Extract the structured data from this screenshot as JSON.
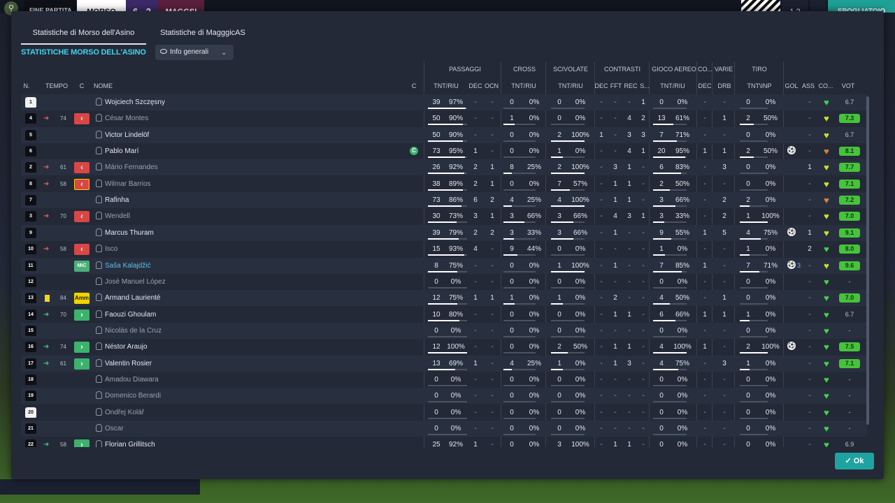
{
  "topbar": {
    "fine_partita": "FINE PARTITA",
    "home_team": "MORSO",
    "score": "6 - 2",
    "away_team": "MAGGSI",
    "mini_score": "1 2",
    "spogliatoio": "SPOGLIATOIO"
  },
  "tabs": [
    "Statistiche di Morso dell'Asino",
    "Statistiche di MagggicAS"
  ],
  "section_title": "STATISTICHE MORSO DELL'ASINO",
  "view_dropdown": "Info generali",
  "ok_label": "Ok",
  "groups": [
    "PASSAGGI",
    "CROSS",
    "SCIVOLATE",
    "CONTRASTI",
    "GIOCO AEREO",
    "CO...",
    "VARIE",
    "TIRO"
  ],
  "columns": {
    "n": "N.",
    "tempo": "TEMPO",
    "c": "C",
    "nome": "NOME",
    "c2": "C",
    "pass_tr": "TNT/RIU",
    "pass_dec": "DEC",
    "pass_ocn": "OCN",
    "cross_tr": "TNT/RIU",
    "sciv_tr": "TNT/RIU",
    "cont_dec": "DEC",
    "cont_fft": "FFT",
    "cont_rec": "REC",
    "cont_s": "S...",
    "aer_tr": "TNT/RIU",
    "co_dec": "DEC",
    "varie_drb": "DRB",
    "tiro_tr": "TNT\\INP",
    "gol": "GOL",
    "ass": "ASS",
    "co": "CO...",
    "vot": "VOT"
  },
  "players": [
    {
      "num": "1",
      "gk": true,
      "ev": "",
      "min": "",
      "badge": "",
      "name": "Wojciech Szczęsny",
      "dim": false,
      "cap": false,
      "p": [
        "39",
        "97%",
        "-",
        "-"
      ],
      "cr": [
        "0",
        "0%"
      ],
      "sc": [
        "0",
        "0%"
      ],
      "ct": [
        "-",
        "-",
        "-",
        "1"
      ],
      "ae": [
        "0",
        "0%"
      ],
      "cd": "-",
      "dr": "-",
      "ti": [
        "0",
        "0%"
      ],
      "gol": "",
      "ass": "-",
      "heart": "#3fd34a",
      "vot": "6.7",
      "vg": false
    },
    {
      "num": "4",
      "gk": false,
      "ev": "out",
      "min": "74",
      "badge": "out",
      "name": "César Montes",
      "dim": true,
      "cap": false,
      "p": [
        "50",
        "90%",
        "-",
        "-"
      ],
      "cr": [
        "1",
        "0%"
      ],
      "sc": [
        "0",
        "0%"
      ],
      "ct": [
        "-",
        "-",
        "4",
        "2"
      ],
      "ae": [
        "13",
        "61%"
      ],
      "cd": "-",
      "dr": "1",
      "ti": [
        "2",
        "50%"
      ],
      "gol": "",
      "ass": "-",
      "heart": "#cde02a",
      "vot": "7.3",
      "vg": true
    },
    {
      "num": "5",
      "gk": false,
      "ev": "",
      "min": "",
      "badge": "",
      "name": "Victor Lindelöf",
      "dim": false,
      "cap": false,
      "p": [
        "50",
        "90%",
        "-",
        "-"
      ],
      "cr": [
        "0",
        "0%"
      ],
      "sc": [
        "2",
        "100%"
      ],
      "ct": [
        "1",
        "-",
        "3",
        "3"
      ],
      "ae": [
        "7",
        "71%"
      ],
      "cd": "-",
      "dr": "-",
      "ti": [
        "0",
        "0%"
      ],
      "gol": "",
      "ass": "-",
      "heart": "#cde02a",
      "vot": "6.7",
      "vg": false
    },
    {
      "num": "6",
      "gk": false,
      "ev": "",
      "min": "",
      "badge": "",
      "name": "Pablo Marí",
      "dim": false,
      "cap": true,
      "p": [
        "73",
        "95%",
        "1",
        "-"
      ],
      "cr": [
        "0",
        "0%"
      ],
      "sc": [
        "1",
        "0%"
      ],
      "ct": [
        "-",
        "-",
        "4",
        "1"
      ],
      "ae": [
        "20",
        "95%"
      ],
      "cd": "1",
      "dr": "1",
      "ti": [
        "2",
        "50%"
      ],
      "gol": "ball",
      "ass": "-",
      "heart": "#d9853a",
      "vot": "8.1",
      "vg": true
    },
    {
      "num": "2",
      "gk": false,
      "ev": "out",
      "min": "61",
      "badge": "out",
      "name": "Mário Fernandes",
      "dim": true,
      "cap": false,
      "p": [
        "26",
        "92%",
        "2",
        "1"
      ],
      "cr": [
        "8",
        "25%"
      ],
      "sc": [
        "2",
        "100%"
      ],
      "ct": [
        "-",
        "3",
        "1",
        "-"
      ],
      "ae": [
        "6",
        "83%"
      ],
      "cd": "-",
      "dr": "3",
      "ti": [
        "0",
        "0%"
      ],
      "gol": "",
      "ass": "1",
      "heart": "#cde02a",
      "vot": "7.7",
      "vg": true
    },
    {
      "num": "8",
      "gk": false,
      "ev": "out",
      "min": "58",
      "badge": "outy",
      "name": "Wilmar Barrios",
      "dim": true,
      "cap": false,
      "p": [
        "38",
        "89%",
        "2",
        "1"
      ],
      "cr": [
        "0",
        "0%"
      ],
      "sc": [
        "7",
        "57%"
      ],
      "ct": [
        "-",
        "1",
        "1",
        "-"
      ],
      "ae": [
        "2",
        "50%"
      ],
      "cd": "-",
      "dr": "-",
      "ti": [
        "0",
        "0%"
      ],
      "gol": "",
      "ass": "-",
      "heart": "#cde02a",
      "vot": "7.1",
      "vg": true
    },
    {
      "num": "7",
      "gk": false,
      "ev": "",
      "min": "",
      "badge": "",
      "name": "Rafinha",
      "dim": false,
      "cap": false,
      "p": [
        "73",
        "86%",
        "6",
        "2"
      ],
      "cr": [
        "4",
        "25%"
      ],
      "sc": [
        "4",
        "100%"
      ],
      "ct": [
        "-",
        "1",
        "1",
        "-"
      ],
      "ae": [
        "3",
        "66%"
      ],
      "cd": "-",
      "dr": "2",
      "ti": [
        "2",
        "0%"
      ],
      "gol": "",
      "ass": "-",
      "heart": "#d9853a",
      "vot": "7.2",
      "vg": true
    },
    {
      "num": "3",
      "gk": false,
      "ev": "out",
      "min": "70",
      "badge": "out",
      "name": "Wendell",
      "dim": true,
      "cap": false,
      "p": [
        "30",
        "73%",
        "3",
        "1"
      ],
      "cr": [
        "3",
        "66%"
      ],
      "sc": [
        "3",
        "66%"
      ],
      "ct": [
        "-",
        "4",
        "3",
        "1"
      ],
      "ae": [
        "3",
        "33%"
      ],
      "cd": "-",
      "dr": "2",
      "ti": [
        "1",
        "100%"
      ],
      "gol": "",
      "ass": "-",
      "heart": "#cde02a",
      "vot": "7.0",
      "vg": true
    },
    {
      "num": "9",
      "gk": false,
      "ev": "",
      "min": "",
      "badge": "",
      "name": "Marcus Thuram",
      "dim": false,
      "cap": false,
      "p": [
        "39",
        "79%",
        "2",
        "2"
      ],
      "cr": [
        "3",
        "33%"
      ],
      "sc": [
        "3",
        "66%"
      ],
      "ct": [
        "-",
        "1",
        "-",
        "-"
      ],
      "ae": [
        "9",
        "55%"
      ],
      "cd": "1",
      "dr": "5",
      "ti": [
        "4",
        "75%"
      ],
      "gol": "ball",
      "ass": "1",
      "heart": "#cde02a",
      "vot": "9.1",
      "vg": true
    },
    {
      "num": "10",
      "gk": false,
      "ev": "out",
      "min": "58",
      "badge": "out",
      "name": "Isco",
      "dim": true,
      "cap": false,
      "p": [
        "15",
        "93%",
        "4",
        "-"
      ],
      "cr": [
        "9",
        "44%"
      ],
      "sc": [
        "0",
        "0%"
      ],
      "ct": [
        "-",
        "-",
        "-",
        "-"
      ],
      "ae": [
        "1",
        "0%"
      ],
      "cd": "-",
      "dr": "-",
      "ti": [
        "1",
        "0%"
      ],
      "gol": "",
      "ass": "2",
      "heart": "#3fd34a",
      "vot": "8.0",
      "vg": true
    },
    {
      "num": "11",
      "gk": false,
      "ev": "",
      "min": "",
      "badge": "mic",
      "name": "Saša Kalajdžić",
      "dim": false,
      "blue": true,
      "cap": false,
      "p": [
        "8",
        "75%",
        "-",
        "-"
      ],
      "cr": [
        "0",
        "0%"
      ],
      "sc": [
        "1",
        "100%"
      ],
      "ct": [
        "-",
        "1",
        "-",
        "-"
      ],
      "ae": [
        "7",
        "85%"
      ],
      "cd": "1",
      "dr": "-",
      "ti": [
        "7",
        "71%"
      ],
      "gol": "ball3",
      "ass": "-",
      "heart": "#cde02a",
      "vot": "9.6",
      "vg": true
    },
    {
      "num": "12",
      "gk": false,
      "ev": "",
      "min": "",
      "badge": "",
      "name": "José Manuel López",
      "dim": true,
      "cap": false,
      "p": [
        "0",
        "0%",
        "-",
        "-"
      ],
      "cr": [
        "0",
        "0%"
      ],
      "sc": [
        "0",
        "0%"
      ],
      "ct": [
        "-",
        "-",
        "-",
        "-"
      ],
      "ae": [
        "0",
        "0%"
      ],
      "cd": "-",
      "dr": "-",
      "ti": [
        "0",
        "0%"
      ],
      "gol": "",
      "ass": "-",
      "heart": "#3fd34a",
      "vot": "-",
      "vg": false
    },
    {
      "num": "13",
      "gk": false,
      "ev": "yc",
      "min": "84",
      "badge": "amm",
      "name": "Armand Laurienté",
      "dim": false,
      "cap": false,
      "p": [
        "12",
        "75%",
        "1",
        "1"
      ],
      "cr": [
        "1",
        "0%"
      ],
      "sc": [
        "1",
        "0%"
      ],
      "ct": [
        "-",
        "2",
        "-",
        "-"
      ],
      "ae": [
        "4",
        "50%"
      ],
      "cd": "-",
      "dr": "1",
      "ti": [
        "0",
        "0%"
      ],
      "gol": "",
      "ass": "-",
      "heart": "#3fd34a",
      "vot": "7.0",
      "vg": true
    },
    {
      "num": "14",
      "gk": false,
      "ev": "in",
      "min": "70",
      "badge": "in",
      "name": "Faouzi Ghoulam",
      "dim": false,
      "cap": false,
      "p": [
        "10",
        "80%",
        "-",
        "-"
      ],
      "cr": [
        "0",
        "0%"
      ],
      "sc": [
        "0",
        "0%"
      ],
      "ct": [
        "-",
        "1",
        "1",
        "-"
      ],
      "ae": [
        "6",
        "66%"
      ],
      "cd": "1",
      "dr": "1",
      "ti": [
        "1",
        "0%"
      ],
      "gol": "",
      "ass": "-",
      "heart": "#3fd34a",
      "vot": "6.7",
      "vg": false
    },
    {
      "num": "15",
      "gk": false,
      "ev": "",
      "min": "",
      "badge": "",
      "name": "Nicolás de la Cruz",
      "dim": true,
      "cap": false,
      "p": [
        "0",
        "0%",
        "-",
        "-"
      ],
      "cr": [
        "0",
        "0%"
      ],
      "sc": [
        "0",
        "0%"
      ],
      "ct": [
        "-",
        "-",
        "-",
        "-"
      ],
      "ae": [
        "0",
        "0%"
      ],
      "cd": "-",
      "dr": "-",
      "ti": [
        "0",
        "0%"
      ],
      "gol": "",
      "ass": "-",
      "heart": "#3fd34a",
      "vot": "-",
      "vg": false
    },
    {
      "num": "16",
      "gk": false,
      "ev": "in",
      "min": "74",
      "badge": "in",
      "name": "Néstor Araujo",
      "dim": false,
      "cap": false,
      "p": [
        "12",
        "100%",
        "-",
        "-"
      ],
      "cr": [
        "0",
        "0%"
      ],
      "sc": [
        "2",
        "50%"
      ],
      "ct": [
        "-",
        "1",
        "1",
        "-"
      ],
      "ae": [
        "4",
        "100%"
      ],
      "cd": "1",
      "dr": "-",
      "ti": [
        "2",
        "100%"
      ],
      "gol": "ball",
      "ass": "-",
      "heart": "#3fd34a",
      "vot": "7.5",
      "vg": true
    },
    {
      "num": "17",
      "gk": false,
      "ev": "in",
      "min": "61",
      "badge": "in",
      "name": "Valentin Rosier",
      "dim": false,
      "cap": false,
      "p": [
        "13",
        "69%",
        "1",
        "-"
      ],
      "cr": [
        "4",
        "25%"
      ],
      "sc": [
        "1",
        "0%"
      ],
      "ct": [
        "-",
        "1",
        "3",
        "-"
      ],
      "ae": [
        "4",
        "75%"
      ],
      "cd": "-",
      "dr": "3",
      "ti": [
        "1",
        "0%"
      ],
      "gol": "",
      "ass": "-",
      "heart": "#3fd34a",
      "vot": "7.1",
      "vg": true
    },
    {
      "num": "18",
      "gk": false,
      "ev": "",
      "min": "",
      "badge": "",
      "name": "Amadou Diawara",
      "dim": true,
      "cap": false,
      "p": [
        "0",
        "0%",
        "-",
        "-"
      ],
      "cr": [
        "0",
        "0%"
      ],
      "sc": [
        "0",
        "0%"
      ],
      "ct": [
        "-",
        "-",
        "-",
        "-"
      ],
      "ae": [
        "0",
        "0%"
      ],
      "cd": "-",
      "dr": "-",
      "ti": [
        "0",
        "0%"
      ],
      "gol": "",
      "ass": "-",
      "heart": "#3fd34a",
      "vot": "-",
      "vg": false
    },
    {
      "num": "19",
      "gk": false,
      "ev": "",
      "min": "",
      "badge": "",
      "name": "Domenico Berardi",
      "dim": true,
      "cap": false,
      "p": [
        "0",
        "0%",
        "-",
        "-"
      ],
      "cr": [
        "0",
        "0%"
      ],
      "sc": [
        "0",
        "0%"
      ],
      "ct": [
        "-",
        "-",
        "-",
        "-"
      ],
      "ae": [
        "0",
        "0%"
      ],
      "cd": "-",
      "dr": "-",
      "ti": [
        "0",
        "0%"
      ],
      "gol": "",
      "ass": "-",
      "heart": "#3fd34a",
      "vot": "-",
      "vg": false
    },
    {
      "num": "20",
      "gk": true,
      "ev": "",
      "min": "",
      "badge": "",
      "name": "Ondřej Kolář",
      "dim": true,
      "cap": false,
      "p": [
        "0",
        "0%",
        "-",
        "-"
      ],
      "cr": [
        "0",
        "0%"
      ],
      "sc": [
        "0",
        "0%"
      ],
      "ct": [
        "-",
        "-",
        "-",
        "-"
      ],
      "ae": [
        "0",
        "0%"
      ],
      "cd": "-",
      "dr": "-",
      "ti": [
        "0",
        "0%"
      ],
      "gol": "",
      "ass": "-",
      "heart": "#3fd34a",
      "vot": "-",
      "vg": false
    },
    {
      "num": "21",
      "gk": false,
      "ev": "",
      "min": "",
      "badge": "",
      "name": "Oscar",
      "dim": true,
      "cap": false,
      "p": [
        "0",
        "0%",
        "-",
        "-"
      ],
      "cr": [
        "0",
        "0%"
      ],
      "sc": [
        "0",
        "0%"
      ],
      "ct": [
        "-",
        "-",
        "-",
        "-"
      ],
      "ae": [
        "0",
        "0%"
      ],
      "cd": "-",
      "dr": "-",
      "ti": [
        "0",
        "0%"
      ],
      "gol": "",
      "ass": "-",
      "heart": "#3fd34a",
      "vot": "-",
      "vg": false
    },
    {
      "num": "22",
      "gk": false,
      "ev": "in",
      "min": "58",
      "badge": "in",
      "name": "Florian Grillitsch",
      "dim": false,
      "cap": false,
      "p": [
        "25",
        "92%",
        "1",
        "-"
      ],
      "cr": [
        "0",
        "0%"
      ],
      "sc": [
        "3",
        "100%"
      ],
      "ct": [
        "-",
        "1",
        "1",
        "-"
      ],
      "ae": [
        "0",
        "0%"
      ],
      "cd": "-",
      "dr": "-",
      "ti": [
        "0",
        "0%"
      ],
      "gol": "",
      "ass": "-",
      "heart": "#3fd34a",
      "vot": "6.9",
      "vg": false
    }
  ]
}
